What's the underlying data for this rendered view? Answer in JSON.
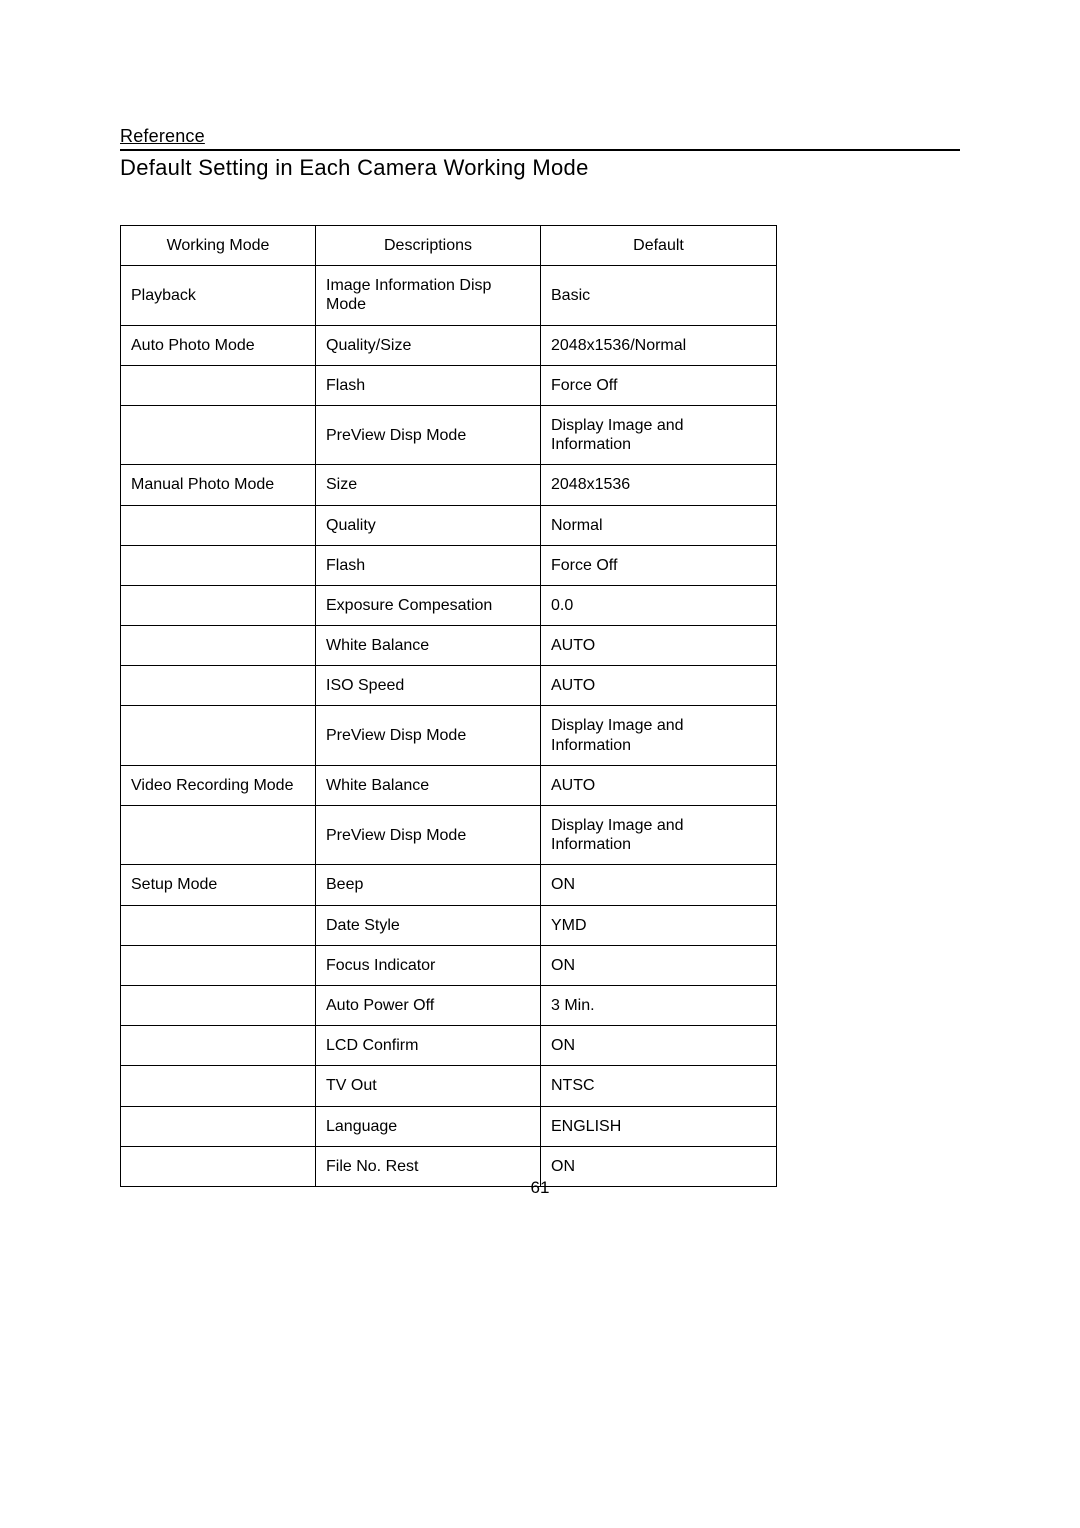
{
  "section_label": "Reference",
  "title": "Default Setting in Each Camera Working Mode",
  "page_number": "61",
  "table": {
    "headers": [
      "Working Mode",
      "Descriptions",
      "Default"
    ],
    "rows": [
      {
        "mode": "Playback",
        "desc": "Image Information Disp Mode",
        "def": "Basic"
      },
      {
        "mode": "Auto Photo Mode",
        "desc": "Quality/Size",
        "def": "2048x1536/Normal"
      },
      {
        "mode": "",
        "desc": "Flash",
        "def": "Force Off"
      },
      {
        "mode": "",
        "desc": "PreView Disp Mode",
        "def": "Display Image and Information"
      },
      {
        "mode": "Manual Photo Mode",
        "desc": "Size",
        "def": "2048x1536"
      },
      {
        "mode": "",
        "desc": "Quality",
        "def": "Normal"
      },
      {
        "mode": "",
        "desc": "Flash",
        "def": "Force Off"
      },
      {
        "mode": "",
        "desc": "Exposure Compesation",
        "def": "0.0"
      },
      {
        "mode": "",
        "desc": "White Balance",
        "def": "AUTO"
      },
      {
        "mode": "",
        "desc": "ISO Speed",
        "def": "AUTO"
      },
      {
        "mode": "",
        "desc": "PreView Disp Mode",
        "def": "Display Image and Information"
      },
      {
        "mode": "Video Recording Mode",
        "desc": "White Balance",
        "def": "AUTO"
      },
      {
        "mode": "",
        "desc": "PreView Disp Mode",
        "def": "Display Image and Information"
      },
      {
        "mode": "Setup Mode",
        "desc": "Beep",
        "def": "ON"
      },
      {
        "mode": "",
        "desc": "Date Style",
        "def": "YMD"
      },
      {
        "mode": "",
        "desc": "Focus Indicator",
        "def": "ON"
      },
      {
        "mode": "",
        "desc": "Auto Power Off",
        "def": "3 Min."
      },
      {
        "mode": "",
        "desc": "LCD Confirm",
        "def": "ON"
      },
      {
        "mode": "",
        "desc": "TV Out",
        "def": "NTSC"
      },
      {
        "mode": "",
        "desc": "Language",
        "def": "ENGLISH"
      },
      {
        "mode": "",
        "desc": "File No. Rest",
        "def": "ON"
      }
    ]
  }
}
